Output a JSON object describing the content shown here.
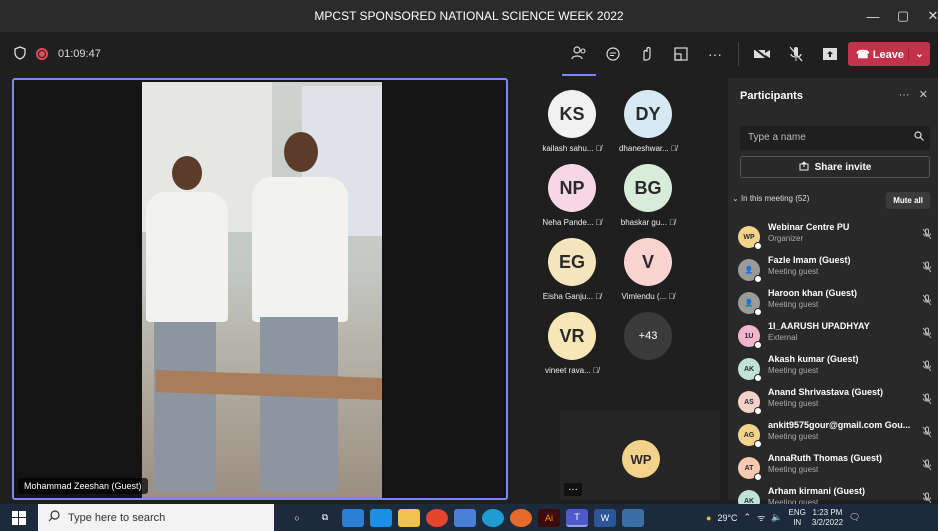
{
  "window": {
    "title": "MPCST SPONSORED NATIONAL SCIENCE WEEK 2022",
    "minimize": "—",
    "maximize": "▢",
    "close": "✕"
  },
  "toolbar": {
    "timer": "01:09:47",
    "leave_label": "Leave"
  },
  "stage": {
    "speaker_name": "Mohammad Zeeshan (Guest)"
  },
  "tiles": [
    {
      "initials": "KS",
      "name": "kailash sahu...",
      "color": "#f1f1f1"
    },
    {
      "initials": "DY",
      "name": "dhaneshwar...",
      "color": "#d6e9f3"
    },
    {
      "initials": "NP",
      "name": "Neha Pande...",
      "color": "#f7d7e6"
    },
    {
      "initials": "BG",
      "name": "bhaskar gu...",
      "color": "#d8ecd9"
    },
    {
      "initials": "EG",
      "name": "Eisha Ganju...",
      "color": "#f5e5bf"
    },
    {
      "initials": "V",
      "name": "Vimlendu (...",
      "color": "#fbd4d2"
    },
    {
      "initials": "VR",
      "name": "vineet rava...",
      "color": "#f7e6b6"
    }
  ],
  "more_count": "+43",
  "self_tile": {
    "initials": "WP",
    "menu": "···"
  },
  "panel": {
    "title": "Participants",
    "more": "···",
    "close": "✕",
    "search_placeholder": "Type a name",
    "invite_label": "Share invite",
    "section_label": "In this meeting (52)",
    "mute_all_label": "Mute all",
    "participants": [
      {
        "initials": "WP",
        "name": "Webinar Centre PU",
        "role": "Organizer",
        "color": "#f3d38a"
      },
      {
        "initials": "",
        "name": "Fazle Imam (Guest)",
        "role": "Meeting guest",
        "color": "#9a9a9a"
      },
      {
        "initials": "",
        "name": "Haroon khan (Guest)",
        "role": "Meeting guest",
        "color": "#9a9a9a"
      },
      {
        "initials": "1U",
        "name": "1I_AARUSH UPADHYAY",
        "role": "External",
        "color": "#f2b5cf"
      },
      {
        "initials": "AK",
        "name": "Akash kumar (Guest)",
        "role": "Meeting guest",
        "color": "#bfe3d6"
      },
      {
        "initials": "AS",
        "name": "Anand Shrivastava (Guest)",
        "role": "Meeting guest",
        "color": "#f5d2c8"
      },
      {
        "initials": "AG",
        "name": "ankit9575gour@gmail.com Gou...",
        "role": "Meeting guest",
        "color": "#f3d38a"
      },
      {
        "initials": "AT",
        "name": "AnnaRuth Thomas (Guest)",
        "role": "Meeting guest",
        "color": "#f6c9b0"
      },
      {
        "initials": "AK",
        "name": "Arham kirmani (Guest)",
        "role": "Meeting guest",
        "color": "#bfe3d6"
      }
    ]
  },
  "taskbar": {
    "search_placeholder": "Type here to search",
    "weather": "29°C",
    "language": "ENG",
    "region": "IN",
    "time": "1:23 PM",
    "date": "3/2/2022"
  }
}
